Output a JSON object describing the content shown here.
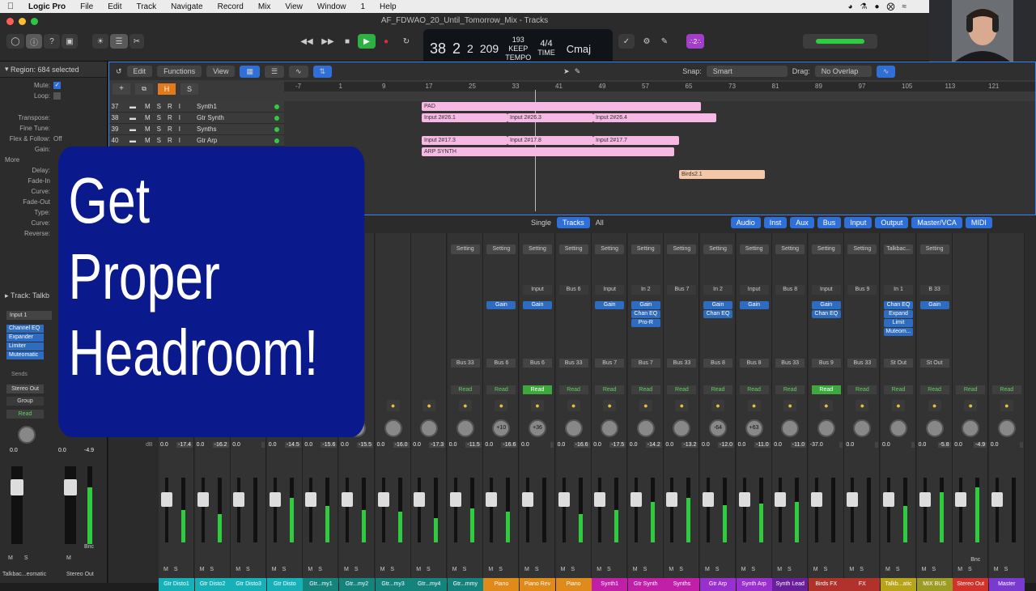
{
  "menubar": {
    "app": "Logic Pro",
    "items": [
      "File",
      "Edit",
      "Track",
      "Navigate",
      "Record",
      "Mix",
      "View",
      "Window",
      "1",
      "Help"
    ]
  },
  "window": {
    "title": "AF_FDWAO_20_Until_Tomorrow_Mix - Tracks"
  },
  "lcd": {
    "bar": "38",
    "beat": "2",
    "div": "2",
    "tick": "209",
    "bar_lbl": "BAR",
    "beat_lbl": "BEAT",
    "div_lbl": "DIV",
    "tick_lbl": "TICK",
    "tempo": "193",
    "tempo_mode": "KEEP",
    "tempo_lbl": "TEMPO",
    "sig": "4/4",
    "time_lbl": "TIME",
    "key": "Cmaj"
  },
  "count_badge": "∴2∴",
  "inspector": {
    "region": "Region: 684 selected",
    "rows": [
      {
        "label": "Mute:",
        "value": "✓"
      },
      {
        "label": "Loop:",
        "value": ""
      },
      {
        "label": "Transpose:",
        "value": ""
      },
      {
        "label": "Fine Tune:",
        "value": ""
      },
      {
        "label": "Flex & Follow:",
        "value": "Off"
      },
      {
        "label": "Gain:",
        "value": ""
      },
      {
        "label": "More",
        "value": ""
      },
      {
        "label": "Delay:",
        "value": ""
      },
      {
        "label": "Fade-In",
        "value": ""
      },
      {
        "label": "Curve:",
        "value": ""
      },
      {
        "label": "Fade-Out",
        "value": ""
      },
      {
        "label": "Type:",
        "value": ""
      },
      {
        "label": "Curve:",
        "value": ""
      },
      {
        "label": "Reverse:",
        "value": ""
      }
    ],
    "track_lbl": "Track: Talkb",
    "input": "Input 1",
    "plugins": [
      "Channel EQ",
      "Expander",
      "Limiter",
      "Muteomatic"
    ],
    "sends": "Sends",
    "stereo_out": "Stereo Out",
    "group": "Group",
    "read": "Read",
    "val_a": "0.0",
    "val_b": "0.0",
    "val_c": "-4.9",
    "bnc": "Bnc",
    "name_a": "Talkbac...eomatic",
    "name_b": "Stereo Out"
  },
  "tracks_toolbar": {
    "edit": "Edit",
    "functions": "Functions",
    "view": "View",
    "snap_lbl": "Snap:",
    "snap": "Smart",
    "drag_lbl": "Drag:",
    "drag": "No Overlap"
  },
  "ruler": [
    "-7",
    "1",
    "9",
    "17",
    "25",
    "33",
    "41",
    "49",
    "57",
    "65",
    "73",
    "81",
    "89",
    "97",
    "105",
    "113",
    "121"
  ],
  "tracks": [
    {
      "num": "37",
      "name": "Synth1"
    },
    {
      "num": "38",
      "name": "Gtr Synth"
    },
    {
      "num": "39",
      "name": "Synths"
    },
    {
      "num": "40",
      "name": "Gtr Arp"
    }
  ],
  "regions": [
    "PAD",
    "Input 2#26.1",
    "Input 2#26.3",
    "Input 2#26.4",
    "Input 2#17.3",
    "Input 2#17.8",
    "Input 2#17.7",
    "ARP SYNTH",
    "Birds2.1"
  ],
  "mixer": {
    "views": [
      "Single",
      "Tracks",
      "All"
    ],
    "filters": [
      "Audio",
      "Inst",
      "Aux",
      "Bus",
      "Input",
      "Output",
      "Master/VCA",
      "MIDI"
    ],
    "db": "dB",
    "strips": [
      {
        "name": "Gtr Disto1",
        "color": "#16b0b8",
        "v1": "0.0",
        "v2": "-17.4"
      },
      {
        "name": "Gtr Disto2",
        "color": "#16b0b8",
        "v1": "0.0",
        "v2": "-16.2"
      },
      {
        "name": "Gtr Disto3",
        "color": "#16b0b8",
        "v1": "0.0",
        "v2": ""
      },
      {
        "name": "Gtr Disto",
        "color": "#16b0b8",
        "v1": "0.0",
        "v2": "-14.5"
      },
      {
        "name": "Gtr...my1",
        "color": "#14837c",
        "v1": "0.0",
        "v2": "-15.6"
      },
      {
        "name": "Gtr...my2",
        "color": "#14837c",
        "v1": "0.0",
        "v2": "-15.5"
      },
      {
        "name": "Gtr...my3",
        "color": "#14837c",
        "v1": "0.0",
        "v2": "-16.0"
      },
      {
        "name": "Gtr...my4",
        "color": "#14837c",
        "v1": "0.0",
        "v2": "-17.3"
      },
      {
        "name": "Gtr...mmy",
        "color": "#14837c",
        "setting": "Setting",
        "send": "Bus 33",
        "v1": "0.0",
        "v2": "-11.5",
        "read": "Read"
      },
      {
        "name": "Piano",
        "color": "#e08a1a",
        "setting": "Setting",
        "plugins": [
          "Gain"
        ],
        "send": "Bus 6",
        "v1": "0.0",
        "v2": "-16.6",
        "knob": "+10",
        "read": "Read"
      },
      {
        "name": "Piano Rev",
        "color": "#e08a1a",
        "setting": "Setting",
        "io": "Input",
        "plugins": [
          "Gain"
        ],
        "send": "Bus 6",
        "v1": "0.0",
        "v2": "",
        "knob": "+36",
        "read": "Read",
        "readOn": true
      },
      {
        "name": "Piano",
        "color": "#e08a1a",
        "setting": "Setting",
        "io": "Bus 6",
        "send": "Bus 33",
        "v1": "0.0",
        "v2": "-16.6",
        "read": "Read"
      },
      {
        "name": "Synth1",
        "color": "#c21fa8",
        "setting": "Setting",
        "io": "Input",
        "plugins": [
          "Gain"
        ],
        "send": "Bus 7",
        "v1": "0.0",
        "v2": "-17.5",
        "read": "Read"
      },
      {
        "name": "Gtr Synth",
        "color": "#c21fa8",
        "setting": "Setting",
        "io": "In 2",
        "plugins": [
          "Gain",
          "Chan EQ",
          "Pro-R"
        ],
        "send": "Bus 7",
        "v1": "0.0",
        "v2": "-14.2",
        "read": "Read"
      },
      {
        "name": "Synths",
        "color": "#c21fa8",
        "setting": "Setting",
        "io": "Bus 7",
        "send": "Bus 33",
        "v1": "0.0",
        "v2": "-13.2",
        "read": "Read"
      },
      {
        "name": "Gtr Arp",
        "color": "#9a2fd0",
        "setting": "Setting",
        "io": "In 2",
        "plugins": [
          "Gain",
          "Chan EQ"
        ],
        "send": "Bus 8",
        "v1": "0.0",
        "v2": "-12.0",
        "knob": "-64",
        "read": "Read"
      },
      {
        "name": "Synth Arp",
        "color": "#9a2fd0",
        "setting": "Setting",
        "io": "Input",
        "plugins": [
          "Gain"
        ],
        "send": "Bus 8",
        "v1": "0.0",
        "v2": "-11.0",
        "knob": "+63",
        "read": "Read"
      },
      {
        "name": "Synth Lead",
        "color": "#6a1f9a",
        "setting": "Setting",
        "io": "Bus 8",
        "send": "Bus 33",
        "v1": "0.0",
        "v2": "-11.0",
        "read": "Read"
      },
      {
        "name": "Birds FX",
        "color": "#b0322a",
        "setting": "Setting",
        "io": "Input",
        "plugins": [
          "Gain",
          "Chan EQ"
        ],
        "send": "Bus 9",
        "v1": "-37.0",
        "v2": "",
        "read": "Read",
        "readOn": true
      },
      {
        "name": "FX",
        "color": "#b0322a",
        "setting": "Setting",
        "io": "Bus 9",
        "send": "Bus 33",
        "v1": "0.0",
        "v2": "",
        "read": "Read"
      },
      {
        "name": "Talkb...atic",
        "color": "#b8a418",
        "setting": "Talkbac...",
        "io": "In 1",
        "plugins": [
          "Chan EQ",
          "Expand",
          "Limit",
          "Muteom..."
        ],
        "send": "St Out",
        "v1": "0.0",
        "v2": "",
        "read": "Read"
      },
      {
        "name": "MIX BUS",
        "color": "#9c9c24",
        "setting": "Setting",
        "io": "B 33",
        "plugins": [
          "Gain"
        ],
        "send": "St Out",
        "v1": "0.0",
        "v2": "-5.8",
        "read": "Read"
      },
      {
        "name": "Stereo Out",
        "color": "#d2322a",
        "v1": "0.0",
        "v2": "-4.9",
        "read": "Read",
        "bnc": "Bnc"
      },
      {
        "name": "Master",
        "color": "#7a3ad0",
        "v1": "0.0",
        "v2": "",
        "read": "Read"
      }
    ]
  },
  "overlay": {
    "line1": "Get",
    "line2": "Proper",
    "line3": "Headroom!"
  }
}
